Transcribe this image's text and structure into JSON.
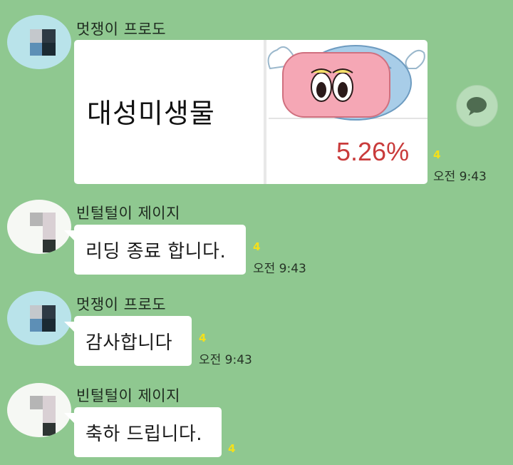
{
  "messages": [
    {
      "sender": "멋쟁이 프로도",
      "card_title": "대성미생물",
      "card_percent": "5.26%",
      "unread": "4",
      "time": "오전 9:43"
    },
    {
      "sender": "빈털털이 제이지",
      "text": "리딩 종료 합니다.",
      "unread": "4",
      "time": "오전 9:43"
    },
    {
      "sender": "멋쟁이 프로도",
      "text": "감사합니다",
      "unread": "4",
      "time": "오전 9:43"
    },
    {
      "sender": "빈털털이 제이지",
      "text": "축하 드립니다.",
      "unread": "4"
    }
  ],
  "icons": {
    "share": "speech-bubble-icon"
  },
  "colors": {
    "background": "#8fc890",
    "unread": "#f5e019",
    "percent": "#c93b3b"
  }
}
